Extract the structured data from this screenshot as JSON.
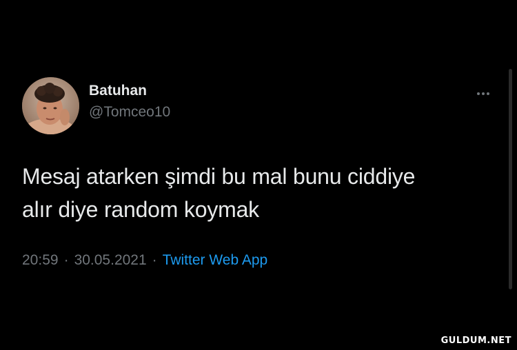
{
  "tweet": {
    "author": {
      "display_name": "Batuhan",
      "handle": "@Tomceo10"
    },
    "text": "Mesaj atarken şimdi bu mal bunu ciddiye\nalır diye random koymak",
    "time": "20:59",
    "separator": "·",
    "date": "30.05.2021",
    "source": "Twitter Web App"
  },
  "watermark": "GULDUM.NET",
  "colors": {
    "background": "#000000",
    "primary_text": "#e7e9ea",
    "secondary_text": "#71767b",
    "link": "#1d9bf0"
  },
  "icons": {
    "more": "more-options-icon"
  }
}
